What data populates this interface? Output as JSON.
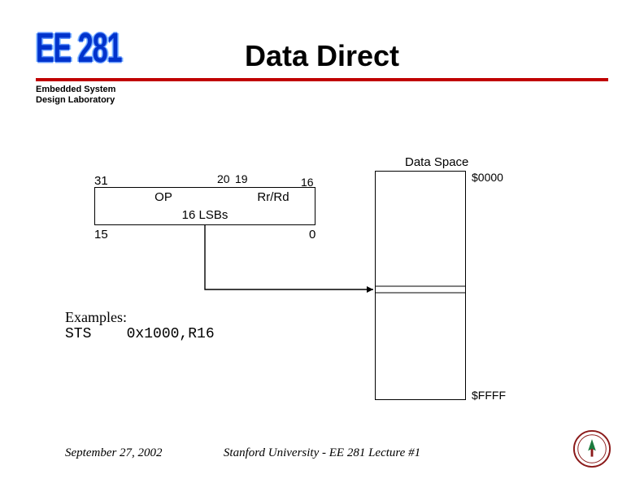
{
  "logo": {
    "text": "EE 281",
    "subtitle_line1": "Embedded System",
    "subtitle_line2": "Design Laboratory"
  },
  "title": "Data Direct",
  "diagram": {
    "data_space_label": "Data Space",
    "bit31": "31",
    "bit20": "20",
    "bit19": "19",
    "bit16": "16",
    "op_label": "OP",
    "rrrd_label": "Rr/Rd",
    "lsb_label": "16 LSBs",
    "bit15": "15",
    "bit0": "0",
    "addr_top": "$0000",
    "addr_bot": "$FFFF"
  },
  "examples": {
    "heading": "Examples:",
    "code_line": "STS    0x1000,R16"
  },
  "footer": {
    "date": "September 27, 2002",
    "center": "Stanford University - EE 281 Lecture #1"
  }
}
